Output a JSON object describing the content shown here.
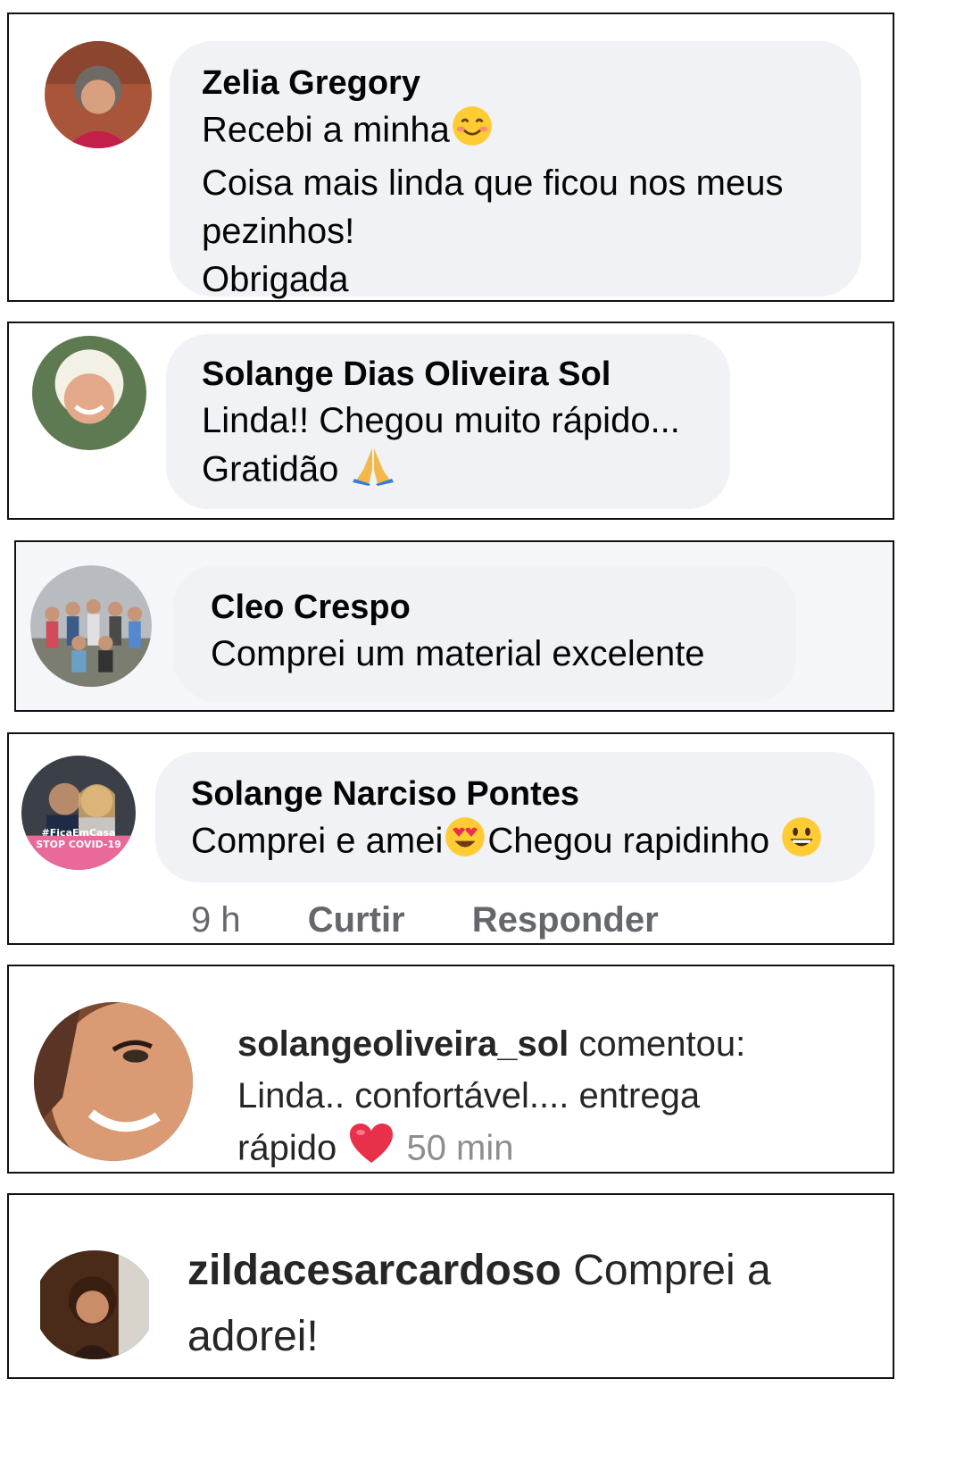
{
  "comments": [
    {
      "name": "Zelia Gregory",
      "lines": [
        "Recebi a minha",
        "Coisa mais linda que ficou nos meus",
        "pezinhos!",
        "Obrigada"
      ],
      "emoji": "smiling-face-icon"
    },
    {
      "name": "Solange Dias Oliveira Sol",
      "lines": [
        "Linda!! Chegou muito rápido...",
        "Gratidão"
      ],
      "emoji": "praying-hands-icon"
    },
    {
      "name": "Cleo Crespo",
      "lines": [
        "Comprei um material excelente"
      ]
    },
    {
      "name": "Solange Narciso Pontes",
      "text_a": "Comprei e amei",
      "text_b": "Chegou rapidinho",
      "emoji_a": "heart-eyes-icon",
      "emoji_b": "grinning-face-icon",
      "avatar_badge_1": "#FicaEmCasa",
      "avatar_badge_2": "STOP COVID-19",
      "time": "9 h",
      "like_label": "Curtir",
      "reply_label": "Responder"
    },
    {
      "username": "solangeoliveira_sol",
      "verb": "comentou:",
      "line1": "Linda.. confortável.... entrega",
      "line2": "rápido",
      "emoji": "red-heart-icon",
      "time": "50 min"
    },
    {
      "username": "zildacesarcardoso",
      "text": "Comprei a",
      "line2": "adorei!"
    }
  ],
  "colors": {
    "bubble": "#f0f2f5",
    "border": "#111111",
    "meta": "#65676b",
    "ig_text": "#262626",
    "ig_time": "#8e8e8e",
    "heart": "#e8304a"
  }
}
